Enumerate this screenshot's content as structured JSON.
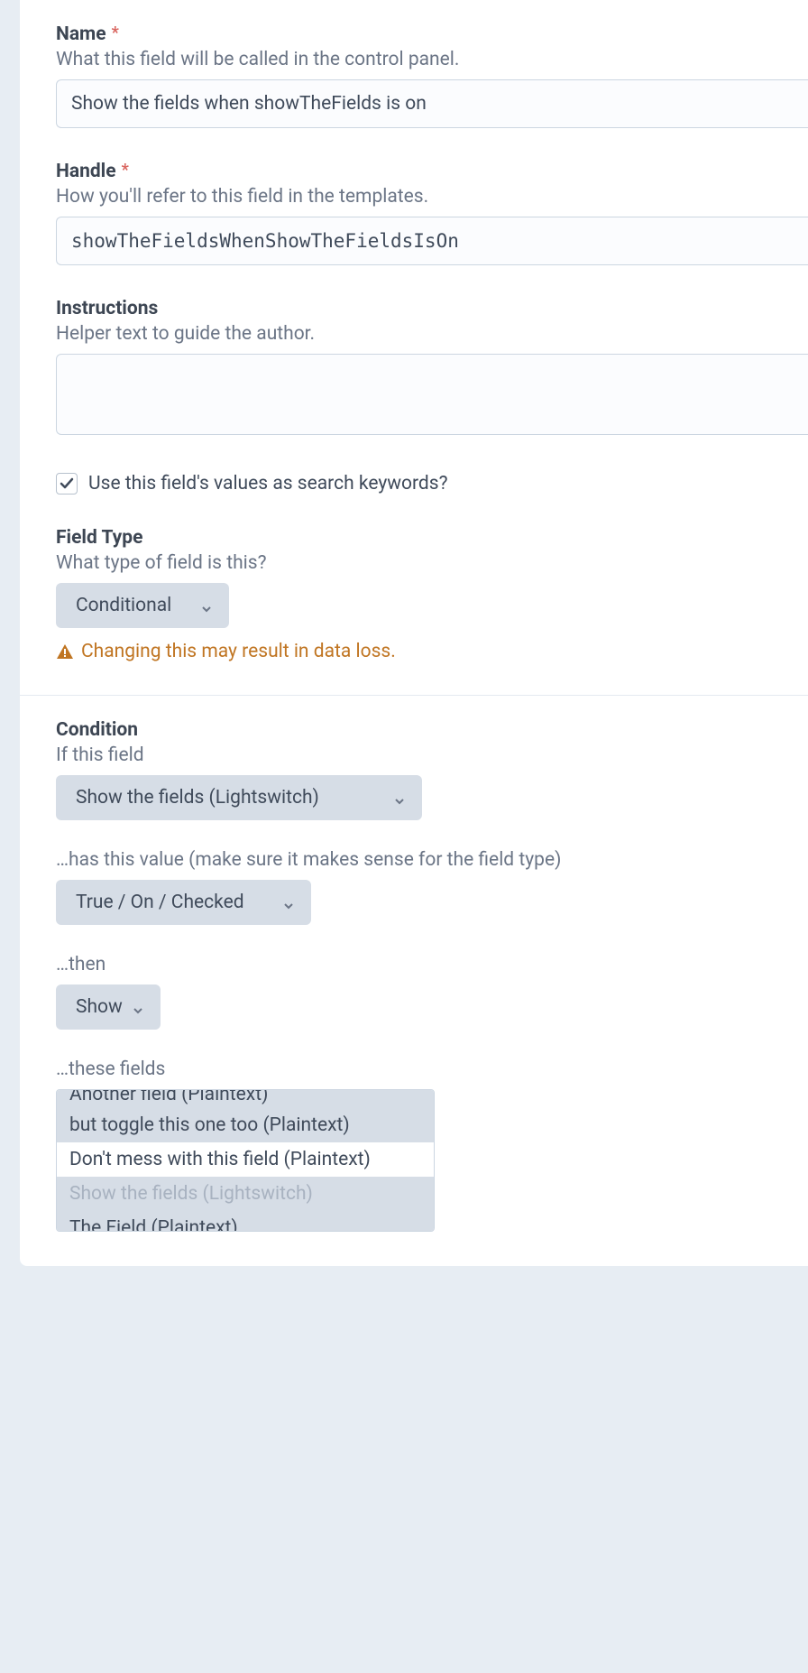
{
  "fields": {
    "name": {
      "label": "Name",
      "hint": "What this field will be called in the control panel.",
      "value": "Show the fields when showTheFields is on"
    },
    "handle": {
      "label": "Handle",
      "hint": "How you'll refer to this field in the templates.",
      "value": "showTheFieldsWhenShowTheFieldsIsOn"
    },
    "instructions": {
      "label": "Instructions",
      "hint": "Helper text to guide the author.",
      "value": ""
    },
    "searchKeywords": {
      "label": "Use this field's values as search keywords?"
    },
    "fieldType": {
      "label": "Field Type",
      "hint": "What type of field is this?",
      "value": "Conditional",
      "warning": "Changing this may result in data loss."
    },
    "condition": {
      "label": "Condition",
      "ifLabel": "If this field",
      "ifValue": "Show the fields (Lightswitch)",
      "hasValueLabel": "…has this value (make sure it makes sense for the field type)",
      "hasValueValue": "True / On / Checked",
      "thenLabel": "…then",
      "thenValue": "Show",
      "theseFieldsLabel": "…these fields",
      "options": {
        "0": {
          "label": "Another field (Plaintext)"
        },
        "1": {
          "label": "but toggle this one too (Plaintext)"
        },
        "2": {
          "label": "Don't mess with this field (Plaintext)"
        },
        "3": {
          "label": "Show the fields (Lightswitch)"
        },
        "4": {
          "label": "The Field (Plaintext)"
        }
      }
    }
  }
}
